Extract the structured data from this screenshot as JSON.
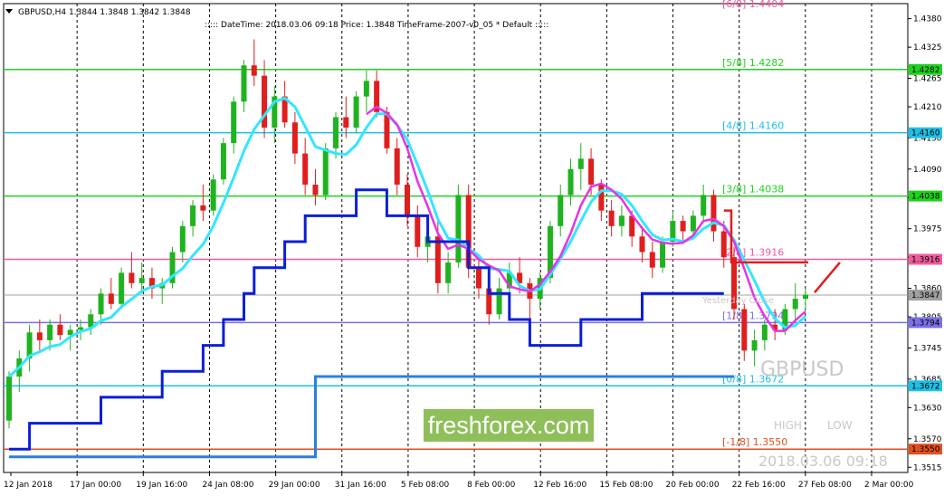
{
  "header": {
    "symbol_line": "GBPUSD,H4  1.3844 1.3848 1.3842 1.3848",
    "info_line": ":::::  DateTime: 2018.03.06 09:18     Price: 1.3848    TimeFrame-2007-v0_05     *  Default    :::::"
  },
  "overlays": {
    "watermark": "freshforex.com",
    "symbol": "GBPUSD",
    "high_label": "HIGH",
    "low_label": "LOW",
    "date_label": "2018.03.06 09:18",
    "yesterday_close": "Yesterday Close"
  },
  "colors": {
    "bull": "#1fb31f",
    "bear": "#e01e1e",
    "ma_cyan": "#33e6ff",
    "ma_magenta": "#e633e6",
    "step_navy": "#0a1fd6",
    "step_blue": "#2b7fe0",
    "red_line": "#e01e1e",
    "grid": "#000000"
  },
  "chart_data": {
    "type": "candlestick",
    "title": "GBPUSD,H4",
    "ylim": [
      1.3505,
      1.4409
    ],
    "y_ticks": [
      "1.4380",
      "1.4325",
      "1.4265",
      "1.4210",
      "1.4150",
      "1.4090",
      "1.4035",
      "1.3975",
      "1.3920",
      "1.3860",
      "1.3805",
      "1.3745",
      "1.3685",
      "1.3630",
      "1.3570",
      "1.3515"
    ],
    "x_ticks": [
      "12 Jan 2018",
      "17 Jan 00:00",
      "19 Jan 16:00",
      "24 Jan 08:00",
      "29 Jan 00:00",
      "31 Jan 16:00",
      "5 Feb 08:00",
      "8 Feb 00:00",
      "12 Feb 16:00",
      "15 Feb 08:00",
      "20 Feb 00:00",
      "22 Feb 16:00",
      "27 Feb 08:00",
      "2 Mar 00:00"
    ],
    "levels": [
      {
        "label": "[5/8]",
        "value": "1.4282",
        "badge": "1.4282",
        "price": 1.4282,
        "color": "#1ed21e"
      },
      {
        "label": "[4/8]",
        "value": "1.4160",
        "badge": "1.4160",
        "price": 1.416,
        "color": "#1ebfe6"
      },
      {
        "label": "[3/8]",
        "value": "1.4038",
        "badge": "1.4038",
        "price": 1.4038,
        "color": "#1ed21e"
      },
      {
        "label": "[2/8]",
        "value": "1.3916",
        "badge": "1.3916",
        "price": 1.3916,
        "color": "#ee5a9c"
      },
      {
        "label": "[1/8]",
        "value": "1.3794",
        "badge": "1.3794",
        "price": 1.3794,
        "color": "#7b6fe8"
      },
      {
        "label": "[0/8]",
        "value": "1.3672",
        "badge": "1.3672",
        "price": 1.3672,
        "color": "#1ebfe6"
      },
      {
        "label": "[-1/8]",
        "value": "1.3550",
        "badge": "1.3550",
        "price": 1.355,
        "color": "#e0501e"
      }
    ],
    "current_price_badge": "1.3847",
    "current_price": 1.3847,
    "top_partial_label": "[6/8]  1.4404",
    "candles": [
      [
        1.3605,
        1.37,
        1.359,
        1.369
      ],
      [
        1.369,
        1.374,
        1.366,
        1.3725
      ],
      [
        1.3725,
        1.379,
        1.37,
        1.3775
      ],
      [
        1.3775,
        1.38,
        1.374,
        1.376
      ],
      [
        1.376,
        1.38,
        1.374,
        1.379
      ],
      [
        1.379,
        1.381,
        1.376,
        1.377
      ],
      [
        1.377,
        1.379,
        1.374,
        1.378
      ],
      [
        1.378,
        1.38,
        1.376,
        1.3785
      ],
      [
        1.3785,
        1.382,
        1.377,
        1.381
      ],
      [
        1.381,
        1.386,
        1.379,
        1.385
      ],
      [
        1.385,
        1.388,
        1.382,
        1.383
      ],
      [
        1.383,
        1.39,
        1.382,
        1.389
      ],
      [
        1.389,
        1.393,
        1.386,
        1.387
      ],
      [
        1.387,
        1.391,
        1.385,
        1.388
      ],
      [
        1.388,
        1.39,
        1.384,
        1.386
      ],
      [
        1.386,
        1.388,
        1.383,
        1.387
      ],
      [
        1.387,
        1.394,
        1.386,
        1.393
      ],
      [
        1.393,
        1.399,
        1.391,
        1.398
      ],
      [
        1.398,
        1.403,
        1.396,
        1.402
      ],
      [
        1.402,
        1.406,
        1.399,
        1.401
      ],
      [
        1.401,
        1.408,
        1.4,
        1.407
      ],
      [
        1.407,
        1.415,
        1.406,
        1.414
      ],
      [
        1.414,
        1.423,
        1.412,
        1.422
      ],
      [
        1.422,
        1.43,
        1.42,
        1.429
      ],
      [
        1.429,
        1.434,
        1.425,
        1.427
      ],
      [
        1.427,
        1.43,
        1.415,
        1.417
      ],
      [
        1.417,
        1.425,
        1.414,
        1.423
      ],
      [
        1.423,
        1.426,
        1.417,
        1.418
      ],
      [
        1.418,
        1.42,
        1.41,
        1.412
      ],
      [
        1.412,
        1.415,
        1.404,
        1.406
      ],
      [
        1.406,
        1.409,
        1.402,
        1.404
      ],
      [
        1.404,
        1.414,
        1.403,
        1.413
      ],
      [
        1.413,
        1.42,
        1.411,
        1.419
      ],
      [
        1.419,
        1.423,
        1.415,
        1.417
      ],
      [
        1.417,
        1.424,
        1.416,
        1.423
      ],
      [
        1.423,
        1.428,
        1.42,
        1.426
      ],
      [
        1.426,
        1.428,
        1.419,
        1.42
      ],
      [
        1.42,
        1.421,
        1.412,
        1.413
      ],
      [
        1.413,
        1.415,
        1.404,
        1.406
      ],
      [
        1.406,
        1.408,
        1.398,
        1.4
      ],
      [
        1.4,
        1.402,
        1.392,
        1.394
      ],
      [
        1.394,
        1.398,
        1.391,
        1.396
      ],
      [
        1.396,
        1.399,
        1.385,
        1.387
      ],
      [
        1.387,
        1.393,
        1.385,
        1.391
      ],
      [
        1.391,
        1.406,
        1.39,
        1.404
      ],
      [
        1.404,
        1.406,
        1.388,
        1.39
      ],
      [
        1.39,
        1.392,
        1.384,
        1.386
      ],
      [
        1.386,
        1.39,
        1.379,
        1.381
      ],
      [
        1.381,
        1.388,
        1.38,
        1.386
      ],
      [
        1.386,
        1.391,
        1.384,
        1.389
      ],
      [
        1.389,
        1.392,
        1.385,
        1.387
      ],
      [
        1.387,
        1.388,
        1.38,
        1.384
      ],
      [
        1.384,
        1.389,
        1.382,
        1.388
      ],
      [
        1.388,
        1.399,
        1.387,
        1.398
      ],
      [
        1.398,
        1.406,
        1.396,
        1.404
      ],
      [
        1.404,
        1.411,
        1.402,
        1.409
      ],
      [
        1.409,
        1.414,
        1.405,
        1.411
      ],
      [
        1.411,
        1.413,
        1.404,
        1.406
      ],
      [
        1.406,
        1.407,
        1.399,
        1.401
      ],
      [
        1.401,
        1.403,
        1.396,
        1.398
      ],
      [
        1.398,
        1.402,
        1.396,
        1.4
      ],
      [
        1.4,
        1.401,
        1.394,
        1.396
      ],
      [
        1.396,
        1.398,
        1.391,
        1.393
      ],
      [
        1.393,
        1.395,
        1.388,
        1.39
      ],
      [
        1.39,
        1.396,
        1.389,
        1.395
      ],
      [
        1.395,
        1.401,
        1.394,
        1.399
      ],
      [
        1.399,
        1.4,
        1.395,
        1.397
      ],
      [
        1.397,
        1.401,
        1.396,
        1.4
      ],
      [
        1.4,
        1.406,
        1.399,
        1.404
      ],
      [
        1.404,
        1.405,
        1.395,
        1.397
      ],
      [
        1.397,
        1.399,
        1.39,
        1.392
      ],
      [
        1.392,
        1.394,
        1.38,
        1.382
      ],
      [
        1.382,
        1.383,
        1.372,
        1.374
      ],
      [
        1.374,
        1.378,
        1.371,
        1.376
      ],
      [
        1.376,
        1.38,
        1.374,
        1.379
      ],
      [
        1.379,
        1.382,
        1.376,
        1.378
      ],
      [
        1.378,
        1.383,
        1.377,
        1.382
      ],
      [
        1.382,
        1.387,
        1.38,
        1.384
      ],
      [
        1.384,
        1.386,
        1.382,
        1.3848
      ]
    ]
  }
}
